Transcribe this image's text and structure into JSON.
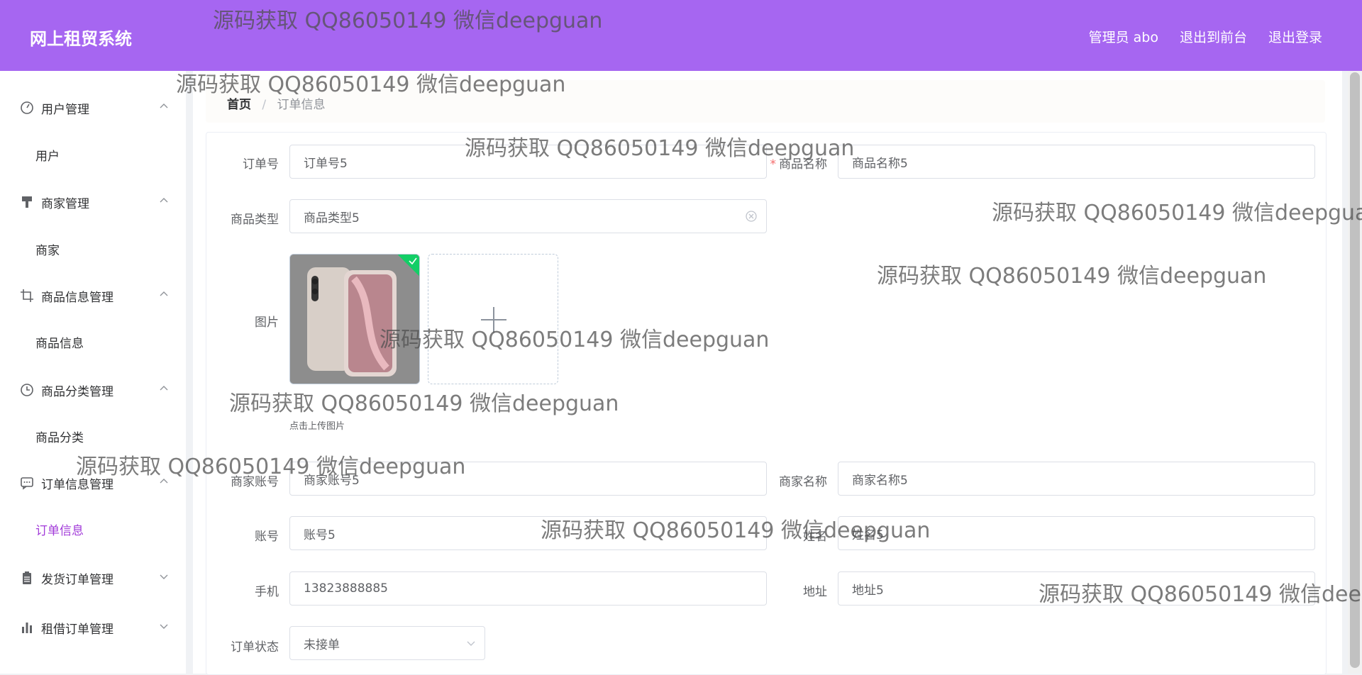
{
  "header": {
    "logo": "网上租贸系统",
    "links": [
      "管理员 abo",
      "退出到前台",
      "退出登录"
    ]
  },
  "sidebar": {
    "groups": [
      {
        "title": "用户管理",
        "icon": "dashboard-icon",
        "expanded": true,
        "items": [
          "用户"
        ]
      },
      {
        "title": "商家管理",
        "icon": "brush-icon",
        "expanded": true,
        "items": [
          "商家"
        ]
      },
      {
        "title": "商品信息管理",
        "icon": "crop-icon",
        "expanded": true,
        "items": [
          "商品信息"
        ]
      },
      {
        "title": "商品分类管理",
        "icon": "clock-icon",
        "expanded": true,
        "items": [
          "商品分类"
        ]
      },
      {
        "title": "订单信息管理",
        "icon": "chat-icon",
        "expanded": true,
        "items": [
          "订单信息"
        ],
        "active_item": "订单信息"
      },
      {
        "title": "发货订单管理",
        "icon": "clipboard-icon",
        "expanded": false,
        "items": []
      },
      {
        "title": "租借订单管理",
        "icon": "bar-chart-icon",
        "expanded": false,
        "items": []
      }
    ],
    "active_color": "#a23bd9"
  },
  "breadcrumb": {
    "home": "首页",
    "separator": "/",
    "current": "订单信息"
  },
  "form": {
    "order_no": {
      "label": "订单号",
      "value": "订单号5"
    },
    "product_name": {
      "label": "商品名称",
      "value": "商品名称5",
      "required": true
    },
    "product_type": {
      "label": "商品类型",
      "value": "商品类型5"
    },
    "image": {
      "label": "图片",
      "hint": "点击上传图片",
      "uploaded_count": 1
    },
    "merchant_account": {
      "label": "商家账号",
      "value": "商家账号5"
    },
    "merchant_name": {
      "label": "商家名称",
      "value": "商家名称5"
    },
    "account": {
      "label": "账号",
      "value": "账号5"
    },
    "name": {
      "label": "姓名",
      "value": "姓名5"
    },
    "phone": {
      "label": "手机",
      "value": "13823888885"
    },
    "address": {
      "label": "地址",
      "value": "地址5"
    },
    "order_status": {
      "label": "订单状态",
      "value": "未接单"
    }
  },
  "watermark": "源码获取 QQ86050149 微信deepguan",
  "colors": {
    "header_bg": "#a666f1",
    "required": "#f56c6c",
    "success": "#13ce66"
  }
}
